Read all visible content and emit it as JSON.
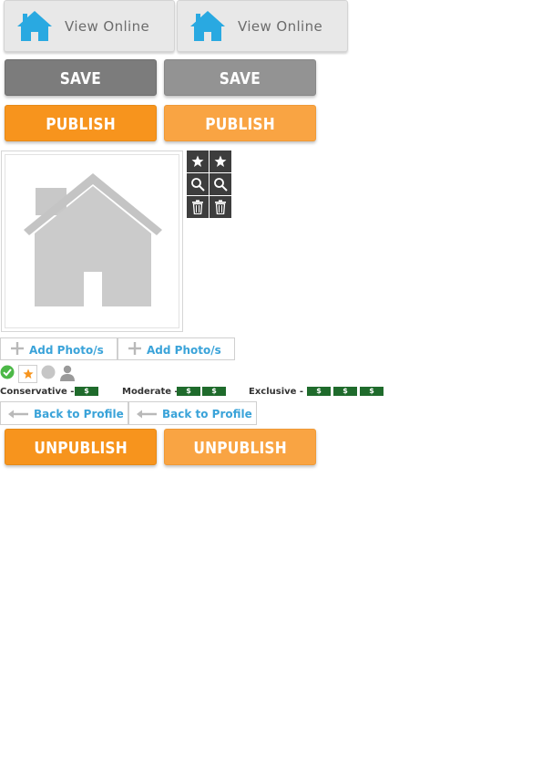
{
  "view_online": [
    {
      "label": "View Online",
      "icon": "house-icon",
      "color": "#29a9e1"
    },
    {
      "label": "View Online",
      "icon": "house-icon",
      "color": "#29a9e1"
    }
  ],
  "save": [
    {
      "label": "SAVE"
    },
    {
      "label": "SAVE"
    }
  ],
  "publish": [
    {
      "label": "PUBLISH"
    },
    {
      "label": "PUBLISH"
    }
  ],
  "unpublish": [
    {
      "label": "UNPUBLISH"
    },
    {
      "label": "UNPUBLISH"
    }
  ],
  "photo": {
    "placeholder_icon": "house-placeholder-icon"
  },
  "tools": [
    "star-icon",
    "magnifier-icon",
    "trash-icon"
  ],
  "add_photo": [
    {
      "label": "Add Photo/s"
    },
    {
      "label": "Add Photo/s"
    }
  ],
  "status_icons": [
    "check-icon",
    "star-badge-icon",
    "gray-dot-icon",
    "person-icon"
  ],
  "price_levels": {
    "conservative": {
      "label": "Conservative -",
      "dollars": [
        "$"
      ]
    },
    "moderate": {
      "label": "Moderate -",
      "dollars": [
        "$",
        "$"
      ]
    },
    "exclusive": {
      "label": "Exclusive -",
      "dollars": [
        "$",
        "$",
        "$"
      ]
    }
  },
  "back_to_profile": [
    {
      "label": "Back to Profile"
    },
    {
      "label": "Back to Profile"
    }
  ],
  "colors": {
    "orange": "#f7941d",
    "blue": "#29a9e1",
    "green": "#1f6b2c",
    "gray": "#7c7c7c"
  }
}
